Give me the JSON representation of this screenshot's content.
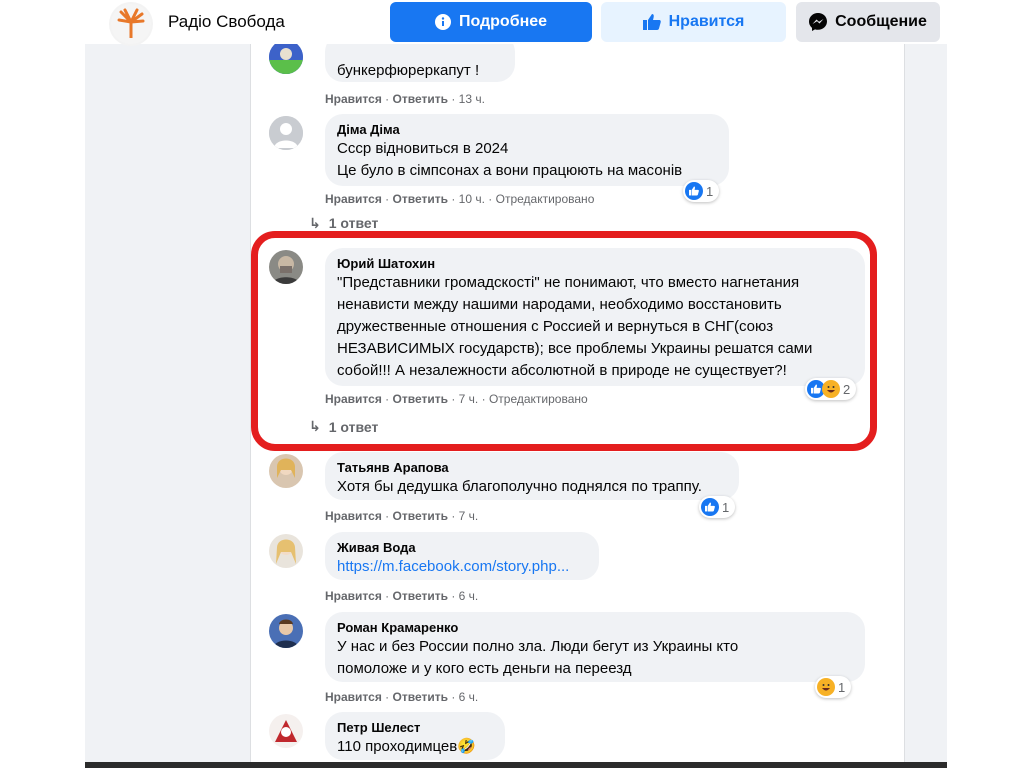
{
  "header": {
    "page_name": "Радіо Свобода",
    "more_button": "Подробнее",
    "like_button": "Нравится",
    "message_button": "Сообщение"
  },
  "action_labels": {
    "like": "Нравится",
    "reply": "Ответить",
    "dot": "·",
    "edited": "Отредактировано"
  },
  "comments": [
    {
      "author": "",
      "lines": [
        "бункерфюреркапут !"
      ],
      "time": "13 ч."
    },
    {
      "author": "Діма Діма",
      "lines": [
        "Ссср відновиться в 2024",
        "Це було в сімпсонах а вони працюють на масонів"
      ],
      "time": "10 ч.",
      "edited": true,
      "reactions": "1",
      "replies": "1 ответ"
    },
    {
      "author": "Юрий Шатохин",
      "lines": [
        "\"Представники громадскості\" не понимают, что вместо нагнетания",
        "ненависти между нашими народами, необходимо восстановить",
        "дружественные отношения с Россией и вернуться в СНГ(союз",
        "НЕЗАВИСИМЫХ государств); все проблемы Украины решатся сами",
        "собой!!! А незалежности абсолютной в природе не существует?!"
      ],
      "time": "7 ч.",
      "edited": true,
      "reactions": "2",
      "replies": "1 ответ"
    },
    {
      "author": "Татьянв Арапова",
      "lines": [
        "Хотя бы дедушка благополучно поднялся по траппу."
      ],
      "time": "7 ч.",
      "reactions": "1"
    },
    {
      "author": "Живая Вода",
      "lines": [
        "https://m.facebook.com/story.php..."
      ],
      "time": "6 ч."
    },
    {
      "author": "Роман Крамаренко",
      "lines": [
        "У нас и без России полно зла. Люди бегут из Украины кто",
        "помоложе и у кого есть деньги на переезд"
      ],
      "time": "6 ч.",
      "reactions": "1"
    },
    {
      "author": "Петр Шелест",
      "lines": [
        "110 проходимцев🤣"
      ]
    }
  ],
  "colors": {
    "accent": "#1877f2",
    "highlight": "#e41e1e",
    "bubble": "#f0f2f5"
  },
  "icons": {
    "logo": "radio-svoboda-logo-icon",
    "info": "info-icon",
    "thumbs_up": "thumbs-up-icon",
    "messenger": "messenger-icon",
    "reply_arrow": "reply-arrow-icon"
  }
}
